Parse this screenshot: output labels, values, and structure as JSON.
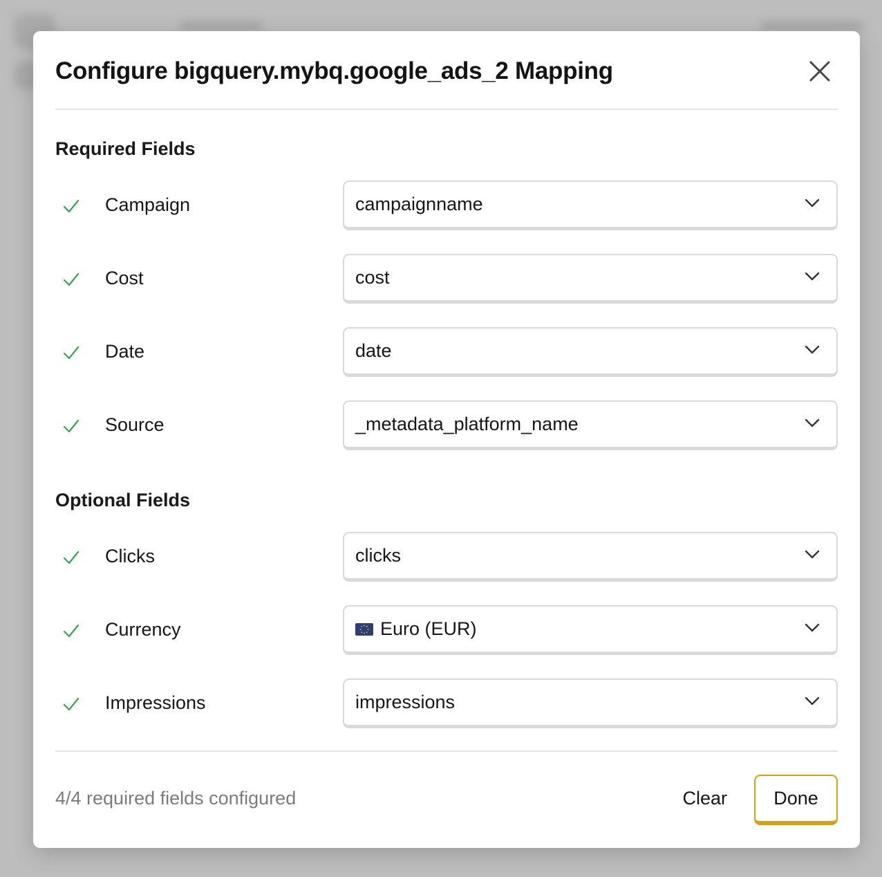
{
  "modal": {
    "title": "Configure bigquery.mybq.google_ads_2 Mapping",
    "close_icon": "close-icon"
  },
  "required_section": {
    "heading": "Required Fields",
    "fields": [
      {
        "label": "Campaign",
        "value": "campaignname",
        "status": "check-icon"
      },
      {
        "label": "Cost",
        "value": "cost",
        "status": "check-icon"
      },
      {
        "label": "Date",
        "value": "date",
        "status": "check-icon"
      },
      {
        "label": "Source",
        "value": "_metadata_platform_name",
        "status": "check-icon"
      }
    ]
  },
  "optional_section": {
    "heading": "Optional Fields",
    "fields": [
      {
        "label": "Clicks",
        "value": "clicks",
        "status": "check-icon"
      },
      {
        "label": "Currency",
        "value": "Euro (EUR)",
        "flag": "eu-flag-icon",
        "status": "check-icon"
      },
      {
        "label": "Impressions",
        "value": "impressions",
        "status": "check-icon"
      }
    ]
  },
  "footer": {
    "status_text": "4/4 required fields configured",
    "clear_label": "Clear",
    "done_label": "Done"
  },
  "colors": {
    "check": "#2fa84f",
    "done_border": "#d4a017",
    "divider": "#e3e3e3"
  }
}
